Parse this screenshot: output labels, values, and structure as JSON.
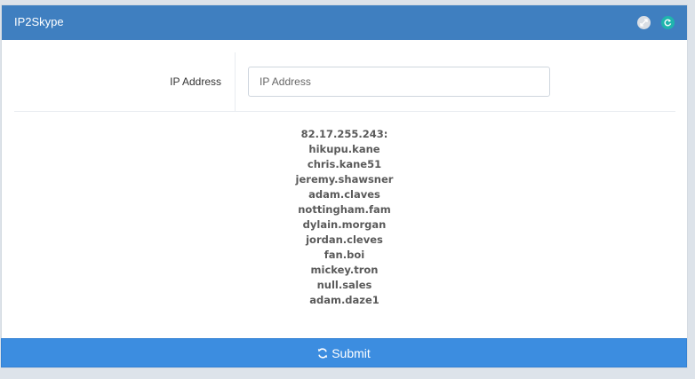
{
  "header": {
    "title": "IP2Skype",
    "expand_icon": "expand-icon",
    "refresh_icon": "refresh-icon",
    "refresh_color": "#1fb5ad",
    "accent": "#3f7fc0"
  },
  "form": {
    "label": "IP Address",
    "placeholder": "IP Address",
    "value": ""
  },
  "results": {
    "ip": "82.17.255.243:",
    "usernames": [
      "hikupu.kane",
      "chris.kane51",
      "jeremy.shawsner",
      "adam.claves",
      "nottingham.fam",
      "dylain.morgan",
      "jordan.cleves",
      "fan.boi",
      "mickey.tron",
      "null.sales",
      "adam.daze1"
    ]
  },
  "submit": {
    "label": "Submit",
    "icon": "refresh-icon",
    "color": "#3c8de0"
  }
}
